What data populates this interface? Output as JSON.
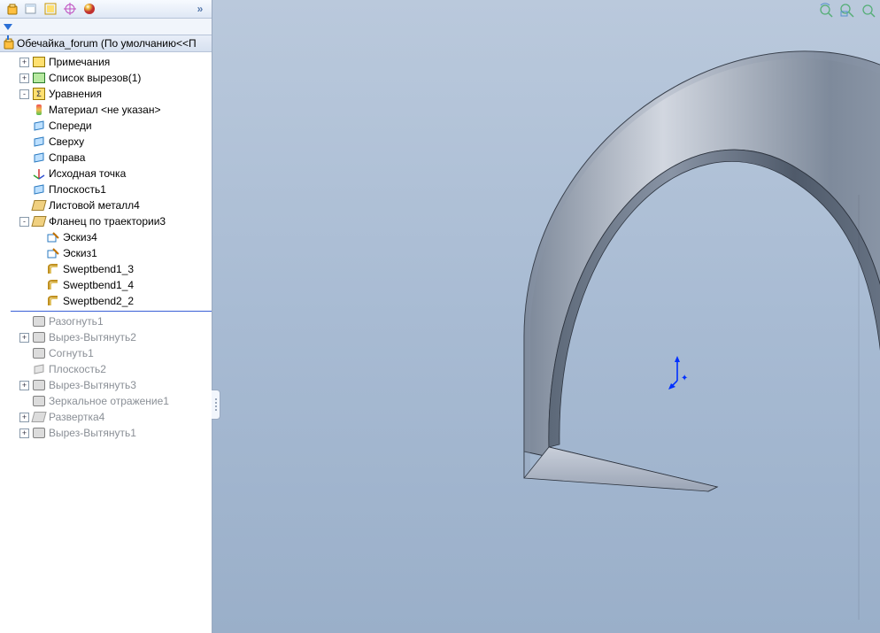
{
  "root": {
    "label": "Обечайка_forum  (По умолчанию<<П"
  },
  "toolbar_icons": [
    "part",
    "doc",
    "config",
    "target",
    "sphere"
  ],
  "tree": [
    {
      "id": "annot",
      "label": "Примечания",
      "indent": 2,
      "exp": "+",
      "icon": "box",
      "suppressed": false
    },
    {
      "id": "cutlist",
      "label": "Список вырезов(1)",
      "indent": 2,
      "exp": "+",
      "icon": "boxgreen",
      "suppressed": false
    },
    {
      "id": "equations",
      "label": "Уравнения",
      "indent": 2,
      "exp": "-",
      "icon": "sigma",
      "suppressed": false
    },
    {
      "id": "material",
      "label": "Материал <не указан>",
      "indent": 2,
      "exp": "",
      "icon": "mat",
      "suppressed": false
    },
    {
      "id": "front",
      "label": "Спереди",
      "indent": 2,
      "exp": "",
      "icon": "plane",
      "suppressed": false
    },
    {
      "id": "top",
      "label": "Сверху",
      "indent": 2,
      "exp": "",
      "icon": "plane",
      "suppressed": false
    },
    {
      "id": "right",
      "label": "Справа",
      "indent": 2,
      "exp": "",
      "icon": "plane",
      "suppressed": false
    },
    {
      "id": "origin",
      "label": "Исходная точка",
      "indent": 2,
      "exp": "",
      "icon": "origin",
      "suppressed": false
    },
    {
      "id": "plane1",
      "label": "Плоскость1",
      "indent": 2,
      "exp": "",
      "icon": "plane",
      "suppressed": false
    },
    {
      "id": "sheetmetal4",
      "label": "Листовой металл4",
      "indent": 2,
      "exp": "",
      "icon": "sheet",
      "suppressed": false
    },
    {
      "id": "sweptflange3",
      "label": "Фланец по траектории3",
      "indent": 2,
      "exp": "-",
      "icon": "sheet",
      "suppressed": false
    },
    {
      "id": "sketch4",
      "label": "Эскиз4",
      "indent": 3,
      "exp": "",
      "icon": "sketch",
      "suppressed": false
    },
    {
      "id": "sketch1",
      "label": "Эскиз1",
      "indent": 3,
      "exp": "",
      "icon": "sketch",
      "suppressed": false
    },
    {
      "id": "sweptbend13",
      "label": "Sweptbend1_3",
      "indent": 3,
      "exp": "",
      "icon": "bend",
      "suppressed": false
    },
    {
      "id": "sweptbend14",
      "label": "Sweptbend1_4",
      "indent": 3,
      "exp": "",
      "icon": "bend",
      "suppressed": false
    },
    {
      "id": "sweptbend22",
      "label": "Sweptbend2_2",
      "indent": 3,
      "exp": "",
      "icon": "bend",
      "suppressed": false
    },
    {
      "id": "__sep__"
    },
    {
      "id": "unfold1",
      "label": "Разогнуть1",
      "indent": 2,
      "exp": "",
      "icon": "feature",
      "suppressed": true
    },
    {
      "id": "cutext2",
      "label": "Вырез-Вытянуть2",
      "indent": 2,
      "exp": "+",
      "icon": "feature",
      "suppressed": true
    },
    {
      "id": "fold1",
      "label": "Согнуть1",
      "indent": 2,
      "exp": "",
      "icon": "feature",
      "suppressed": true
    },
    {
      "id": "plane2",
      "label": "Плоскость2",
      "indent": 2,
      "exp": "",
      "icon": "planesupp",
      "suppressed": true
    },
    {
      "id": "cutext3",
      "label": "Вырез-Вытянуть3",
      "indent": 2,
      "exp": "+",
      "icon": "feature",
      "suppressed": true
    },
    {
      "id": "mirror1",
      "label": "Зеркальное отражение1",
      "indent": 2,
      "exp": "",
      "icon": "feature",
      "suppressed": true
    },
    {
      "id": "flat4",
      "label": "Развертка4",
      "indent": 2,
      "exp": "+",
      "icon": "sheetsupp",
      "suppressed": true
    },
    {
      "id": "cutext1",
      "label": "Вырез-Вытянуть1",
      "indent": 2,
      "exp": "+",
      "icon": "feature",
      "suppressed": true
    }
  ],
  "viewport_icons": [
    "zoom-rotate",
    "zoom-area",
    "zoom-fit"
  ]
}
